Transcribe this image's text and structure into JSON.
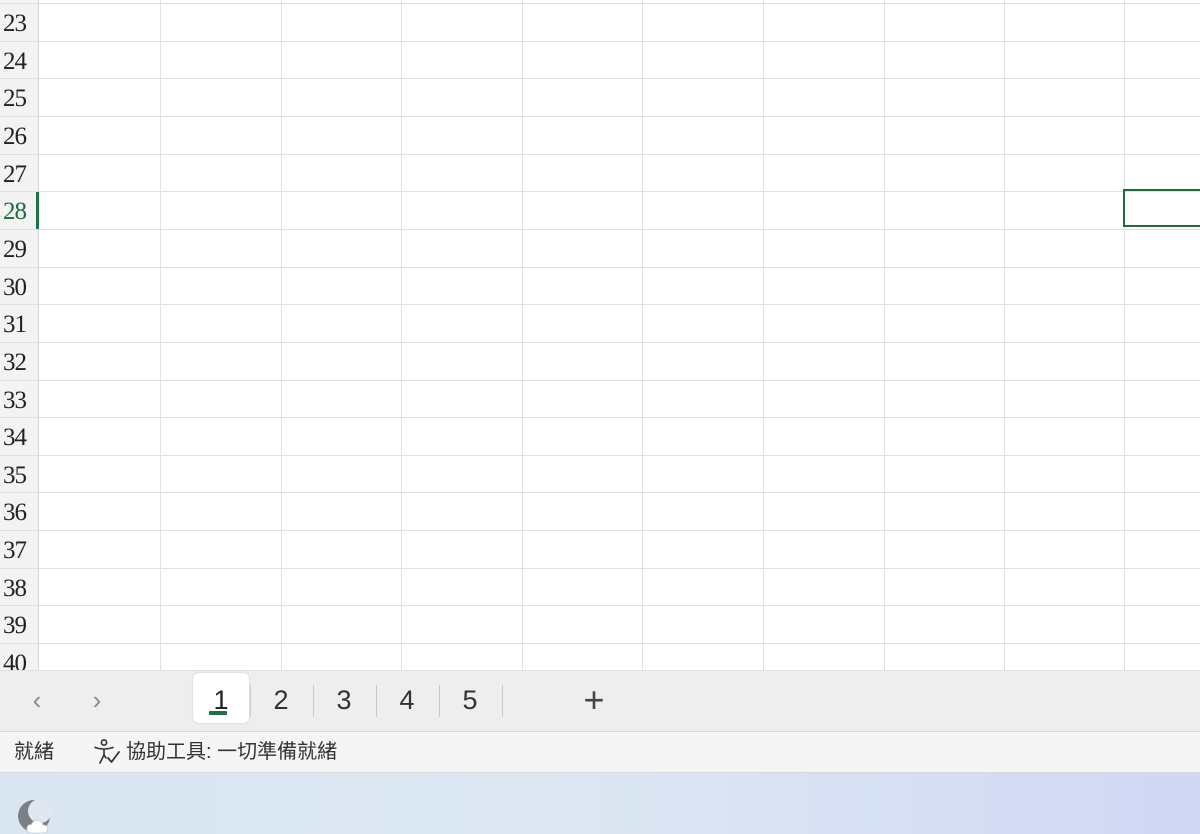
{
  "grid": {
    "row_numbers": [
      "23",
      "24",
      "25",
      "26",
      "27",
      "28",
      "29",
      "30",
      "31",
      "32",
      "33",
      "34",
      "35",
      "36",
      "37",
      "38",
      "39",
      "40"
    ],
    "active_row": "28"
  },
  "sheet_tabs": {
    "prev_icon": "chevron-left-icon",
    "next_icon": "chevron-right-icon",
    "tabs": [
      {
        "label": "1",
        "active": true
      },
      {
        "label": "2",
        "active": false
      },
      {
        "label": "3",
        "active": false
      },
      {
        "label": "4",
        "active": false
      },
      {
        "label": "5",
        "active": false
      }
    ],
    "add_icon": "plus-icon",
    "add_glyph": "+",
    "prev_glyph": "‹",
    "next_glyph": "›"
  },
  "status_bar": {
    "ready_text": "就緒",
    "accessibility_text": "協助工具: 一切準備就緒",
    "accessibility_icon": "accessibility-check-icon"
  },
  "taskbar": {
    "weather_icon": "weather-cloud-moon-icon"
  },
  "colors": {
    "accent": "#1e7145",
    "gridline": "#e1e1e1",
    "tabbar_bg": "#eeeeee"
  }
}
